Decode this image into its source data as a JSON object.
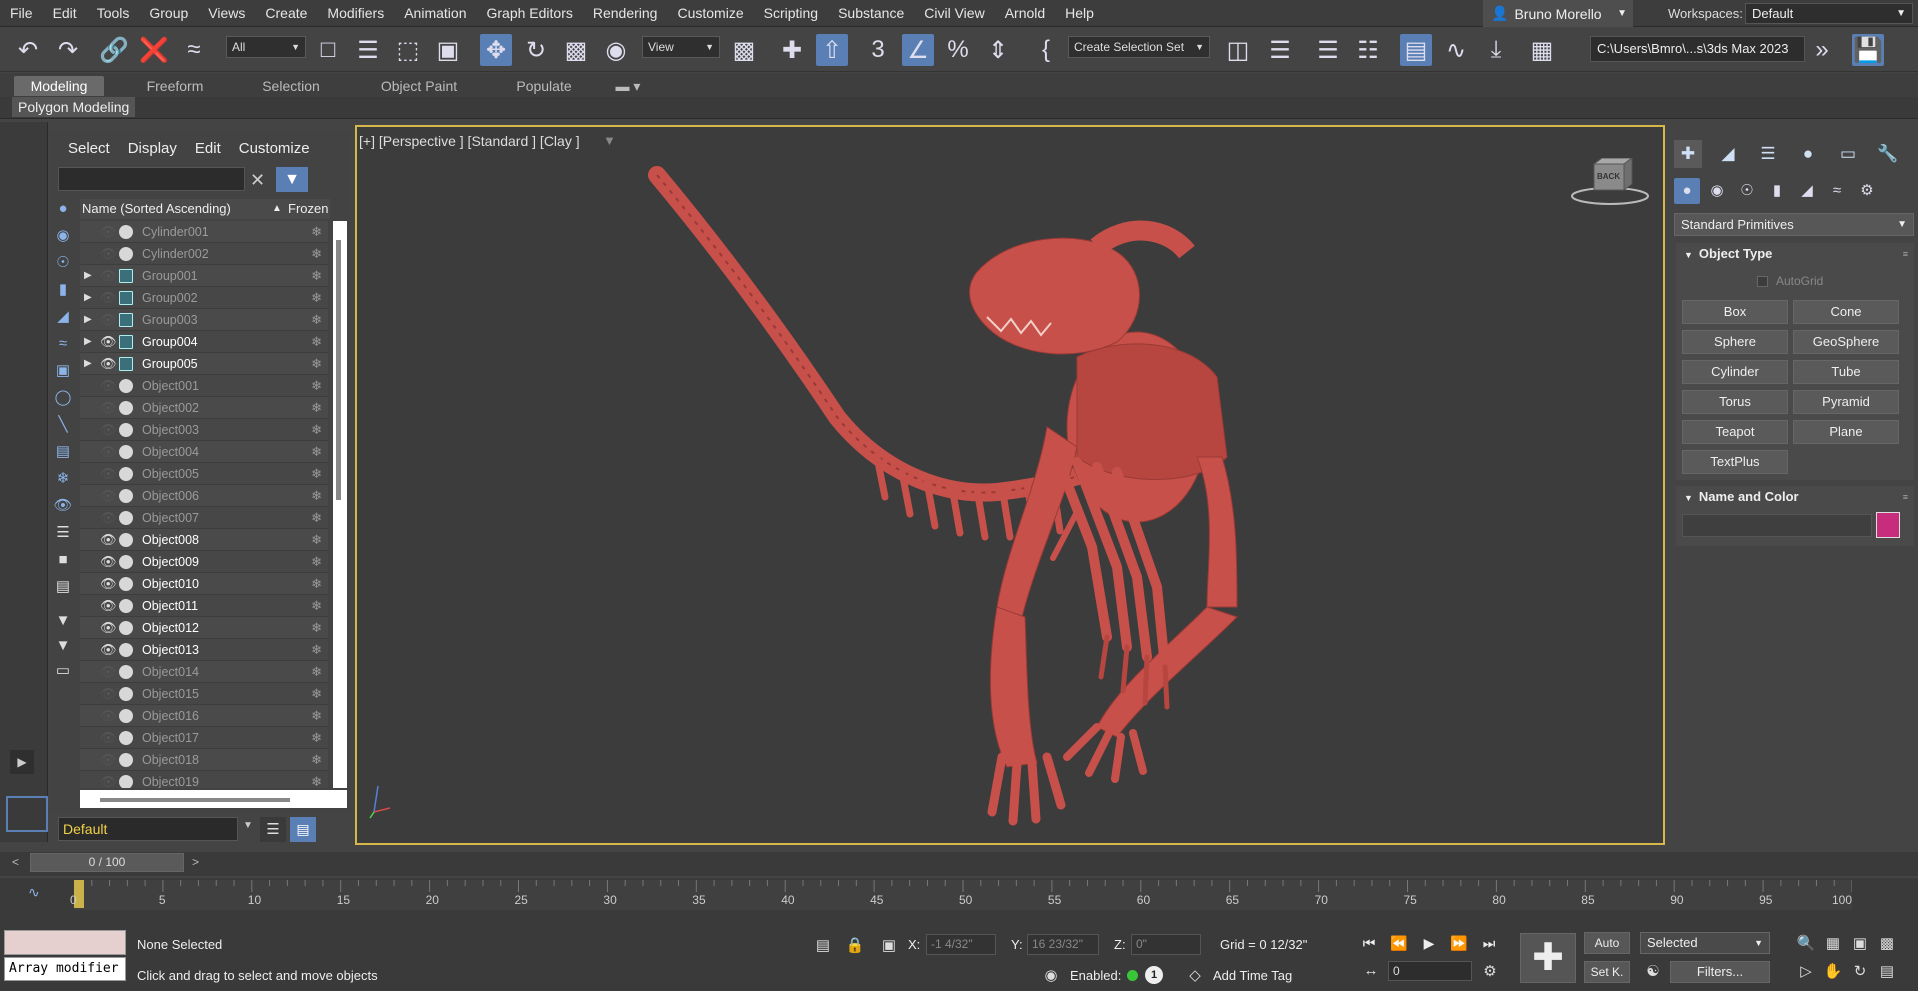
{
  "menubar": {
    "items": [
      "File",
      "Edit",
      "Tools",
      "Group",
      "Views",
      "Create",
      "Modifiers",
      "Animation",
      "Graph Editors",
      "Rendering",
      "Customize",
      "Scripting",
      "Substance",
      "Civil View",
      "Arnold",
      "Help"
    ],
    "user": "Bruno Morello",
    "workspace_label": "Workspaces:",
    "workspace_value": "Default"
  },
  "toolbar": {
    "filter_select": "All",
    "view_select": "View",
    "selection_set": "Create Selection Set",
    "path": "C:\\Users\\Bmro\\...s\\3ds Max 2023"
  },
  "ribbon": {
    "tabs": [
      "Modeling",
      "Freeform",
      "Selection",
      "Object Paint",
      "Populate"
    ],
    "active": "Modeling",
    "subtab": "Polygon Modeling"
  },
  "explorer": {
    "menu": [
      "Select",
      "Display",
      "Edit",
      "Customize"
    ],
    "header_name": "Name (Sorted Ascending)",
    "header_frozen": "Frozen",
    "rows": [
      {
        "name": "Cylinder001",
        "type": "object",
        "visible": false,
        "group": false
      },
      {
        "name": "Cylinder002",
        "type": "object",
        "visible": false,
        "group": false
      },
      {
        "name": "Group001",
        "type": "group",
        "visible": false,
        "group": true
      },
      {
        "name": "Group002",
        "type": "group",
        "visible": false,
        "group": true
      },
      {
        "name": "Group003",
        "type": "group",
        "visible": false,
        "group": true
      },
      {
        "name": "Group004",
        "type": "group",
        "visible": true,
        "group": true
      },
      {
        "name": "Group005",
        "type": "group",
        "visible": true,
        "group": true
      },
      {
        "name": "Object001",
        "type": "object",
        "visible": false,
        "group": false
      },
      {
        "name": "Object002",
        "type": "object",
        "visible": false,
        "group": false
      },
      {
        "name": "Object003",
        "type": "object",
        "visible": false,
        "group": false
      },
      {
        "name": "Object004",
        "type": "object",
        "visible": false,
        "group": false
      },
      {
        "name": "Object005",
        "type": "object",
        "visible": false,
        "group": false
      },
      {
        "name": "Object006",
        "type": "object",
        "visible": false,
        "group": false
      },
      {
        "name": "Object007",
        "type": "object",
        "visible": false,
        "group": false
      },
      {
        "name": "Object008",
        "type": "object",
        "visible": true,
        "group": false
      },
      {
        "name": "Object009",
        "type": "object",
        "visible": true,
        "group": false
      },
      {
        "name": "Object010",
        "type": "object",
        "visible": true,
        "group": false
      },
      {
        "name": "Object011",
        "type": "object",
        "visible": true,
        "group": false
      },
      {
        "name": "Object012",
        "type": "object",
        "visible": true,
        "group": false
      },
      {
        "name": "Object013",
        "type": "object",
        "visible": true,
        "group": false
      },
      {
        "name": "Object014",
        "type": "object",
        "visible": false,
        "group": false
      },
      {
        "name": "Object015",
        "type": "object",
        "visible": false,
        "group": false
      },
      {
        "name": "Object016",
        "type": "object",
        "visible": false,
        "group": false
      },
      {
        "name": "Object017",
        "type": "object",
        "visible": false,
        "group": false
      },
      {
        "name": "Object018",
        "type": "object",
        "visible": false,
        "group": false
      },
      {
        "name": "Object019",
        "type": "object",
        "visible": false,
        "group": false
      }
    ],
    "layer": "Default"
  },
  "viewport": {
    "label": "[+] [Perspective ] [Standard ] [Clay ]",
    "viewcube_face": "BACK",
    "model_color": "#c8504a"
  },
  "command_panel": {
    "category": "Standard Primitives",
    "object_type_title": "Object Type",
    "autogrid": "AutoGrid",
    "primitives": [
      "Box",
      "Cone",
      "Sphere",
      "GeoSphere",
      "Cylinder",
      "Tube",
      "Torus",
      "Pyramid",
      "Teapot",
      "Plane",
      "TextPlus"
    ],
    "name_color_title": "Name and Color",
    "swatch_color": "#c82c7c"
  },
  "timeline": {
    "slider": "0 / 100",
    "ticks": [
      "0",
      "5",
      "10",
      "15",
      "20",
      "25",
      "30",
      "35",
      "40",
      "45",
      "50",
      "55",
      "60",
      "65",
      "70",
      "75",
      "80",
      "85",
      "90",
      "95",
      "100"
    ]
  },
  "status": {
    "maxscript": "Array modifier",
    "selection": "None Selected",
    "prompt": "Click and drag to select and move objects",
    "x_label": "X:",
    "x_value": "-1 4/32\"",
    "y_label": "Y:",
    "y_value": "16 23/32\"",
    "z_label": "Z:",
    "z_value": "0\"",
    "grid": "Grid = 0 12/32\"",
    "enabled": "Enabled:",
    "enabled_num": "1",
    "time_tag": "Add Time Tag",
    "frame": "0",
    "auto": "Auto",
    "setk": "Set K.",
    "selected": "Selected",
    "filters": "Filters..."
  }
}
